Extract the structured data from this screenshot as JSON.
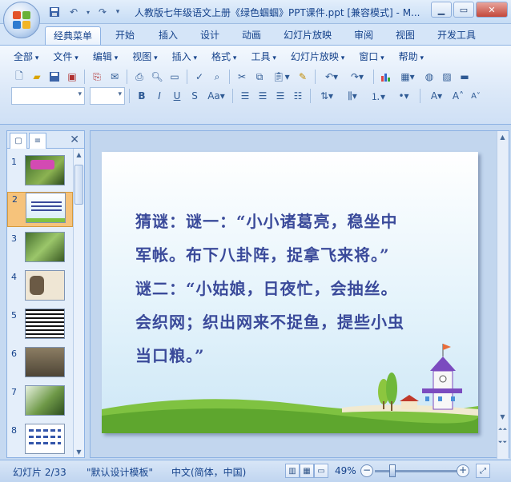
{
  "window": {
    "title": "人教版七年级语文上册《绿色蝈蝈》PPT课件.ppt [兼容模式] - M...",
    "buttons": [
      "minimize",
      "maximize",
      "close"
    ]
  },
  "ribbon_tabs": [
    {
      "label": "经典菜单",
      "active": true
    },
    {
      "label": "开始"
    },
    {
      "label": "插入"
    },
    {
      "label": "设计"
    },
    {
      "label": "动画"
    },
    {
      "label": "幻灯片放映"
    },
    {
      "label": "审阅"
    },
    {
      "label": "视图"
    },
    {
      "label": "开发工具"
    }
  ],
  "menus": [
    "全部",
    "文件",
    "编辑",
    "视图",
    "插入",
    "格式",
    "工具",
    "幻灯片放映",
    "窗口",
    "帮助"
  ],
  "slides_panel": {
    "count_label_numbers": [
      "1",
      "2",
      "3",
      "4",
      "5",
      "6",
      "7",
      "8"
    ],
    "selected": 2
  },
  "slide": {
    "lines": [
      "猜谜：谜一：“小小诸葛亮，稳坐中",
      "军帐。布下八卦阵，捉拿飞来将。”",
      "谜二：“小姑娘，日夜忙，会抽丝。",
      "会织网；织出网来不捉鱼，提些小虫",
      "当口粮。”"
    ],
    "text_color": "#3a4a9a"
  },
  "statusbar": {
    "slide_info": "幻灯片 2/33",
    "template": "\"默认设计模板\"",
    "language": "中文(简体，中国)",
    "zoom": "49%",
    "zoom_fraction": 0.49
  },
  "colors": {
    "accent": "#15428b",
    "selection": "#f6c37b"
  }
}
